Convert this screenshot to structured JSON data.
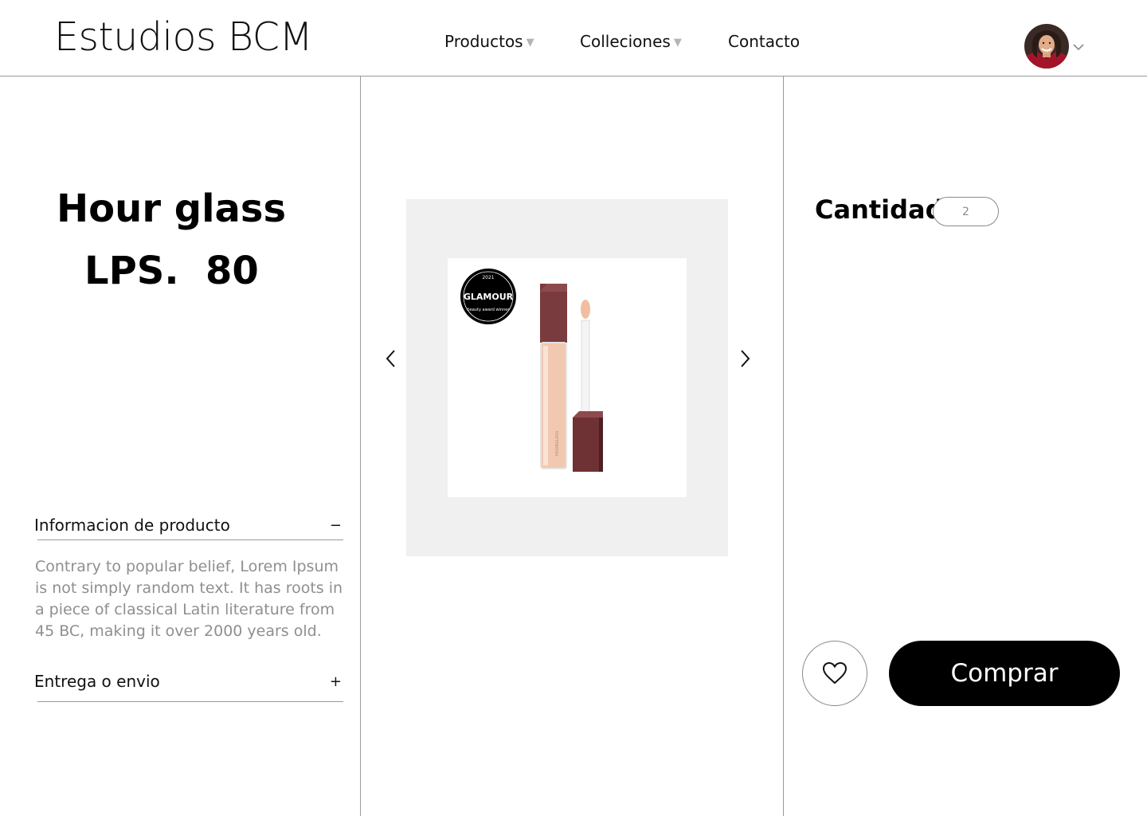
{
  "header": {
    "brand": "Estudios BCM",
    "nav": {
      "productos": "Productos",
      "colleciones": "Colleciones",
      "contacto": "Contacto"
    },
    "caret_glyph": "▼"
  },
  "product": {
    "name": "Hour glass",
    "price": "LPS.  80",
    "image_badge": {
      "year": "2021",
      "name": "GLAMOUR",
      "caption": "beauty award winner"
    },
    "image_brand": "HOURGLASS"
  },
  "accordion": [
    {
      "title": "Informacion de producto",
      "toggle": "−",
      "expanded": true,
      "body": "Contrary to popular belief, Lorem Ipsum is not simply random text. It has roots in a piece of classical Latin literature from 45 BC, making it over 2000 years old."
    },
    {
      "title": "Entrega o envio",
      "toggle": "+",
      "expanded": false
    }
  ],
  "purchase": {
    "quantity_label": "Cantidad:",
    "quantity_value": "2",
    "buy_label": "Comprar"
  },
  "colors": {
    "gallery_bg": "#f0f0f0",
    "divider": "#9a9a9a",
    "body_text_muted": "#8f8f8f",
    "buy_button": "#000000",
    "tube_cap": "#7a3b3e",
    "tube_fill": "#f1c9b0"
  },
  "icons": {
    "nav_caret": "triangle-down-icon",
    "avatar_caret": "chevron-down-icon",
    "prev": "chevron-left-icon",
    "next": "chevron-right-icon",
    "favorite": "heart-icon"
  }
}
